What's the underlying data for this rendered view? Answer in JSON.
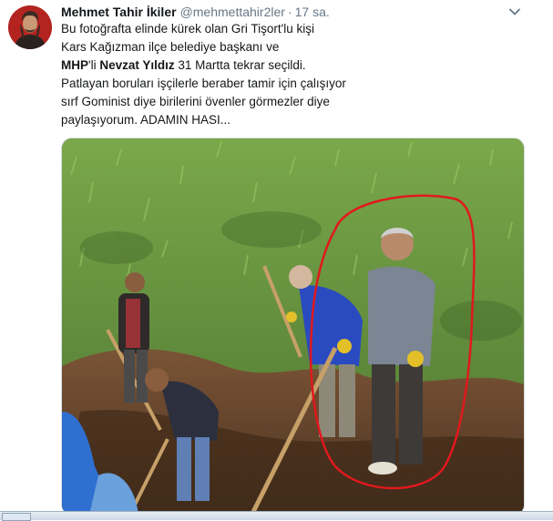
{
  "tweet": {
    "display_name": "Mehmet Tahir İkiler",
    "handle": "@mehmettahir2ler",
    "separator": "·",
    "time": "17 sa.",
    "lines": [
      "Bu fotoğrafta elinde kürek olan Gri Tişort'lu kişi",
      "Kars Kağızman ilçe belediye başkanı ve"
    ],
    "line3": {
      "party": "MHP",
      "party_suffix": "'li ",
      "name": "Nevzat Yıldız",
      "rest": " 31 Martta tekrar seçildi."
    },
    "lines_after": [
      "Patlayan boruları işçilerle beraber tamir için çalışıyor",
      "sırf Gominist diye birilerini övenler görmezler diye",
      "paylaşıyorum. ADAMIN HASI..."
    ],
    "menu_icon": "chevron-down-icon",
    "media": {
      "subject": "photo of workers digging a trench, one man circled in red"
    }
  },
  "colors": {
    "text": "#14171a",
    "secondary": "#657786",
    "circle": "#e0191d",
    "grass": "#5f8a3a",
    "soil": "#6b4a2e"
  }
}
